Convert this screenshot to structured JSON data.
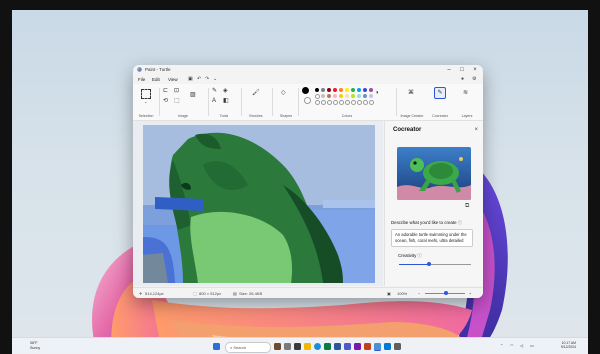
{
  "window": {
    "title": "Paint - Turtle",
    "menu": [
      "File",
      "Edit",
      "View"
    ],
    "groups": [
      "Selection",
      "Image",
      "Tools",
      "Brushes",
      "Shapes",
      "Colors",
      "Image Creator",
      "Cocreator",
      "Layers"
    ]
  },
  "cocreator": {
    "title": "Cocreator",
    "describe_label": "Describe what you'd like to create",
    "prompt": "An adorable turtle swimming under the ocean, fish, coral reefs, ultra detailed",
    "creativity_label": "Creativity",
    "creativity_level": 0.42
  },
  "statusbar": {
    "cursor": "514,124px",
    "dimensions": "800 × 512px",
    "size": "Size: 26.4KB",
    "zoom": "100%"
  },
  "taskbar": {
    "weather_temp": "58°F",
    "weather_cond": "Sunny",
    "search_placeholder": "Search",
    "time": "10:17 AM",
    "date": "9/12/2024"
  },
  "colors": {
    "palette": [
      "#000000",
      "#7f7f7f",
      "#880015",
      "#ed1c24",
      "#ff7f27",
      "#fff200",
      "#22b14c",
      "#00a2e8",
      "#3f48cc",
      "#a349a4",
      "#ffffff",
      "#c3c3c3",
      "#b97a57",
      "#ffaec9",
      "#ffc90e",
      "#efe4b0",
      "#b5e61d",
      "#99d9ea",
      "#7092be",
      "#c8bfe7"
    ],
    "accent": "#2b58d6"
  }
}
